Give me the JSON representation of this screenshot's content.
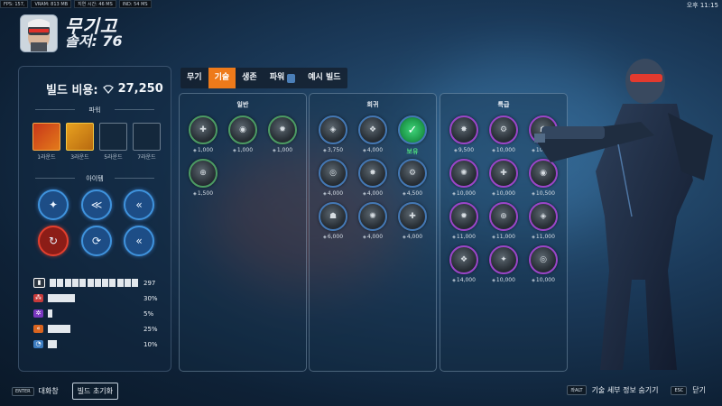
{
  "system": {
    "stats": [
      "FPS: 157,",
      "VRAM: 813 MB",
      "지연 시간: 46 MS",
      "IND: 54 MS"
    ],
    "clock": "오후 11:15"
  },
  "hero": {
    "name": "무기고",
    "subtitle": "솔저: 76"
  },
  "build": {
    "cost_label": "빌드 비용:",
    "cost_value": "27,250",
    "power_section": "파워",
    "powers": [
      {
        "round": "1라운드",
        "filled": true
      },
      {
        "round": "3라운드",
        "filled": true
      },
      {
        "round": "5라운드",
        "filled": false
      },
      {
        "round": "7라운드",
        "filled": false
      }
    ],
    "items_section": "아이템"
  },
  "stats": [
    {
      "icon": "ammo-icon",
      "color": "#ffffff",
      "value": "297",
      "segments": 12,
      "fill": 1.0
    },
    {
      "icon": "weapon-power-icon",
      "color": "#e04a4a",
      "value": "30%",
      "fill": 0.3
    },
    {
      "icon": "ability-power-icon",
      "color": "#a050e0",
      "value": "5%",
      "fill": 0.05
    },
    {
      "icon": "attack-speed-icon",
      "color": "#f07a2a",
      "value": "25%",
      "fill": 0.25
    },
    {
      "icon": "cooldown-icon",
      "color": "#5aa0e0",
      "value": "10%",
      "fill": 0.1
    }
  ],
  "tabs": [
    {
      "label": "무기",
      "active": false
    },
    {
      "label": "기술",
      "active": true
    },
    {
      "label": "생존",
      "active": false
    },
    {
      "label": "파워",
      "active": false
    },
    {
      "label": "예시 빌드",
      "active": false
    }
  ],
  "columns": [
    {
      "title": "일반",
      "tier": "green",
      "items": [
        {
          "price": "1,000"
        },
        {
          "price": "1,000"
        },
        {
          "price": "1,000"
        },
        {
          "price": "1,500"
        }
      ]
    },
    {
      "title": "희귀",
      "tier": "blue",
      "items": [
        {
          "price": "3,750"
        },
        {
          "price": "4,000"
        },
        {
          "price": "보유",
          "owned": true
        },
        {
          "price": "4,000"
        },
        {
          "price": "4,000"
        },
        {
          "price": "4,500"
        },
        {
          "price": "6,000"
        },
        {
          "price": "4,000"
        },
        {
          "price": "4,000"
        }
      ]
    },
    {
      "title": "특급",
      "tier": "purple",
      "items": [
        {
          "price": "9,500"
        },
        {
          "price": "10,000"
        },
        {
          "price": "10,000"
        },
        {
          "price": "10,000"
        },
        {
          "price": "10,000"
        },
        {
          "price": "10,500"
        },
        {
          "price": "11,000"
        },
        {
          "price": "11,000"
        },
        {
          "price": "11,000"
        },
        {
          "price": "14,000"
        },
        {
          "price": "10,000"
        },
        {
          "price": "10,000"
        }
      ]
    }
  ],
  "footer": {
    "enter_key": "ENTER",
    "chat_label": "대화창",
    "reset_button": "빌드 초기화",
    "alt_key": "좌ALT",
    "hide_info_label": "기술 세부 정보 숨기기",
    "esc_key": "ESC",
    "close_label": "닫기"
  }
}
